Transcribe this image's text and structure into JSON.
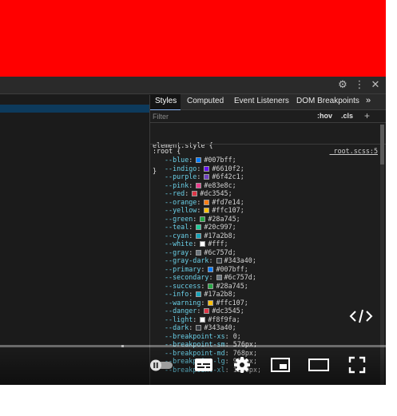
{
  "devtools": {
    "toolbar_icons": [
      "gear-icon",
      "more-vertical-icon",
      "close-icon"
    ],
    "tabs": [
      {
        "label": "Styles",
        "active": true
      },
      {
        "label": "Computed"
      },
      {
        "label": "Event Listeners"
      },
      {
        "label": "DOM Breakpoints"
      }
    ],
    "tab_overflow": "»",
    "filter": {
      "placeholder": "Filter",
      "hov": ":hov",
      "cls": ".cls",
      "add": "+"
    },
    "element_style": {
      "selector": "element.style {",
      "close": "}"
    },
    "root_rule": {
      "selector": ":root {",
      "source": "_root.scss:5",
      "variables": [
        {
          "name": "--blue",
          "value": "#007bff",
          "swatch": "#007bff"
        },
        {
          "name": "--indigo",
          "value": "#6610f2",
          "swatch": "#6610f2"
        },
        {
          "name": "--purple",
          "value": "#6f42c1",
          "swatch": "#6f42c1"
        },
        {
          "name": "--pink",
          "value": "#e83e8c",
          "swatch": "#e83e8c"
        },
        {
          "name": "--red",
          "value": "#dc3545",
          "swatch": "#dc3545"
        },
        {
          "name": "--orange",
          "value": "#fd7e14",
          "swatch": "#fd7e14"
        },
        {
          "name": "--yellow",
          "value": "#ffc107",
          "swatch": "#ffc107"
        },
        {
          "name": "--green",
          "value": "#28a745",
          "swatch": "#28a745"
        },
        {
          "name": "--teal",
          "value": "#20c997",
          "swatch": "#20c997"
        },
        {
          "name": "--cyan",
          "value": "#17a2b8",
          "swatch": "#17a2b8"
        },
        {
          "name": "--white",
          "value": "#fff",
          "swatch": "#ffffff"
        },
        {
          "name": "--gray",
          "value": "#6c757d",
          "swatch": "#6c757d"
        },
        {
          "name": "--gray-dark",
          "value": "#343a40",
          "swatch": "#343a40"
        },
        {
          "name": "--primary",
          "value": "#007bff",
          "swatch": "#007bff"
        },
        {
          "name": "--secondary",
          "value": "#6c757d",
          "swatch": "#6c757d"
        },
        {
          "name": "--success",
          "value": "#28a745",
          "swatch": "#28a745"
        },
        {
          "name": "--info",
          "value": "#17a2b8",
          "swatch": "#17a2b8"
        },
        {
          "name": "--warning",
          "value": "#ffc107",
          "swatch": "#ffc107"
        },
        {
          "name": "--danger",
          "value": "#dc3545",
          "swatch": "#dc3545"
        },
        {
          "name": "--light",
          "value": "#f8f9fa",
          "swatch": "#f8f9fa"
        },
        {
          "name": "--dark",
          "value": "#343a40",
          "swatch": "#343a40"
        },
        {
          "name": "--breakpoint-xs",
          "value": "0"
        },
        {
          "name": "--breakpoint-sm",
          "value": "576px"
        },
        {
          "name": "--breakpoint-md",
          "value": "768px"
        },
        {
          "name": "--breakpoint-lg",
          "value": "992px"
        },
        {
          "name": "--breakpoint-xl",
          "value": "1200px"
        }
      ]
    }
  },
  "player": {
    "embed_icon": "code-icon",
    "controls": [
      "autoplay-toggle-icon",
      "subtitles-icon",
      "settings-icon",
      "miniplayer-icon",
      "theater-mode-icon",
      "fullscreen-icon"
    ]
  },
  "colors": {
    "banner": "#ff0000",
    "variable_name": "#6ad0e8",
    "panel_bg": "#1e1e1e"
  }
}
